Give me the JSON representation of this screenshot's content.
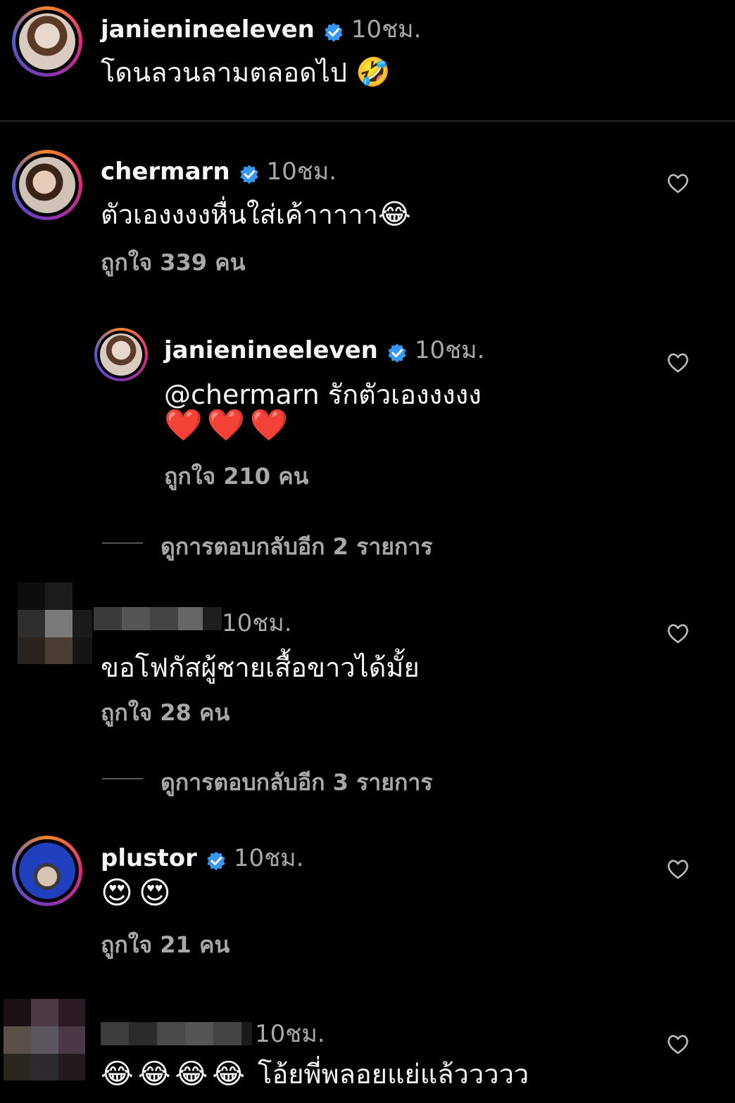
{
  "comments": [
    {
      "username": "janienineeleven",
      "time": "10ชม.",
      "text": "โดนลวนลามตลอดไป",
      "emoji": "🤣"
    },
    {
      "username": "chermarn",
      "time": "10ชม.",
      "text": "ตัวเองงงงหื่นใส่เค้าาาาา",
      "emoji": "😂",
      "likes": "ถูกใจ 339 คน"
    },
    {
      "username": "janienineeleven",
      "time": "10ชม.",
      "text": "@chermarn รักตัวเองงงงง",
      "emoji": "❤️❤️❤️",
      "likes": "ถูกใจ 210 คน"
    },
    {
      "view_replies": "ดูการตอบกลับอีก 2 รายการ"
    },
    {
      "time": "10ชม.",
      "text": "ขอโฟกัสผู้ชายเสื้อขาวได้มั้ย",
      "likes": "ถูกใจ 28 คน"
    },
    {
      "view_replies": "ดูการตอบกลับอีก 3 รายการ"
    },
    {
      "username": "plustor",
      "time": "10ชม.",
      "emoji": "😍😍",
      "likes": "ถูกใจ 21 คน"
    },
    {
      "time": "10ชม.",
      "emoji": "😂😂😂😂",
      "text": "โอ้ยพี่พลอยแย่แล้ววววว"
    }
  ],
  "colors": {
    "background": "#000000",
    "verified": "#3897f0",
    "secondary": "#a8a8a8"
  }
}
